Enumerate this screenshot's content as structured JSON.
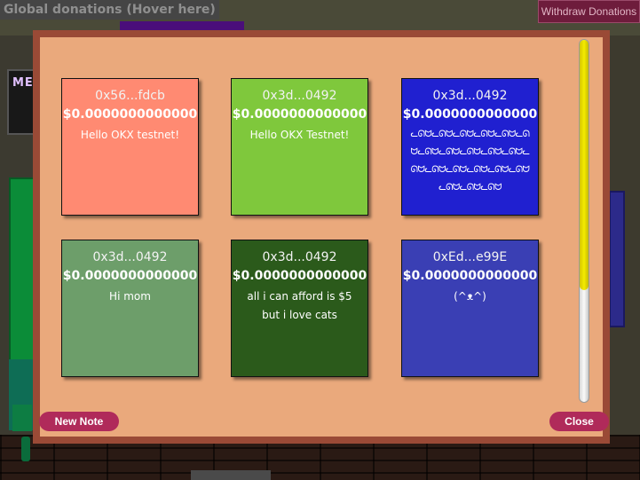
{
  "header": {
    "global_label": "Global donations (Hover here)",
    "withdraw_label": "Withdraw Donations"
  },
  "scene": {
    "side_label": "MEN"
  },
  "modal": {
    "new_note_label": "New Note",
    "close_label": "Close",
    "notes": [
      {
        "address": "0x56...fdcb",
        "amount": "$0.0000000000000",
        "message": "Hello OKX testnet!",
        "color": "#ff8a72"
      },
      {
        "address": "0x3d...0492",
        "amount": "$0.0000000000000",
        "message": "Hello OKX Testnet!",
        "color": "#7fc83c"
      },
      {
        "address": "0x3d...0492",
        "amount": "$0.0000000000000",
        "message": "ᓚᘏᗢᓚᘏᗢᓚᘏᗢᓚᘏᗢᓚᘏᗢᓚᘏᗢᓚᘏᗢᓚᘏᗢᓚᘏᗢᓚᘏᗢᓚᘏᗢᓚᘏᗢᓚᘏᗢᓚᘏᗢᓚᘏᗢᓚᘏᗢᓚᘏᗢᓚᘏᗢᓚᘏᗢᓚᘏᗢ",
        "color": "#2020d0"
      },
      {
        "address": "0x3d...0492",
        "amount": "$0.0000000000000",
        "message": "Hi mom",
        "color": "#6d9e6a"
      },
      {
        "address": "0x3d...0492",
        "amount": "$0.0000000000000",
        "message": "all i can afford is $5 but i love cats",
        "color": "#2b5a1b"
      },
      {
        "address": "0xEd...e99E",
        "amount": "$0.0000000000000",
        "message": "(^ᴥ^)",
        "color": "#3a3fb4"
      }
    ]
  },
  "scrollbar": {
    "thumb_fraction": 0.69
  }
}
